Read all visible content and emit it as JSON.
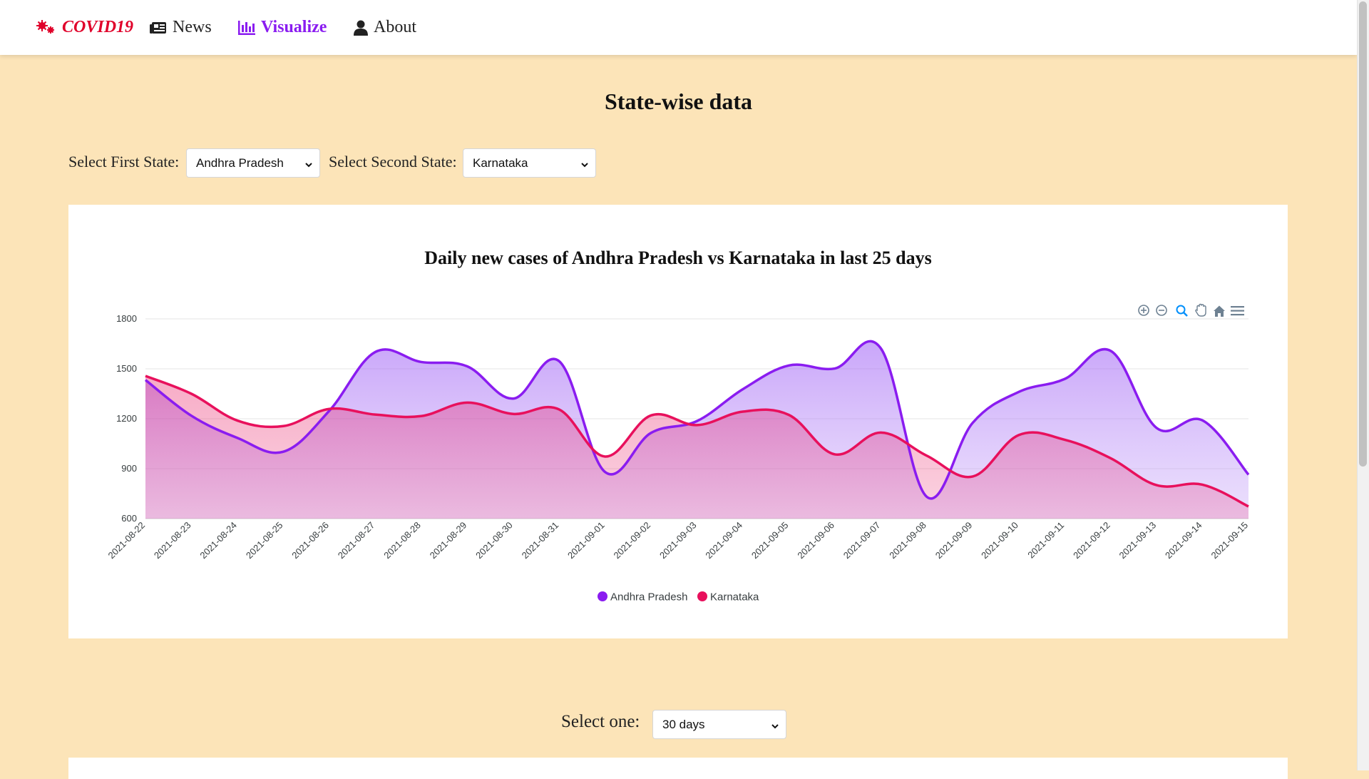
{
  "navbar": {
    "brand": "COVID19",
    "items": [
      {
        "label": "News",
        "icon": "newspaper-icon"
      },
      {
        "label": "Visualize",
        "icon": "bar-chart-icon",
        "active": true
      },
      {
        "label": "About",
        "icon": "user-icon"
      }
    ]
  },
  "page": {
    "title": "State-wise data",
    "first_state_label": "Select First State:",
    "first_state_value": "Andhra Pradesh",
    "second_state_label": "Select Second State:",
    "second_state_value": "Karnataka",
    "select_one_label": "Select one:",
    "select_one_value": "30 days"
  },
  "colors": {
    "background": "#fce4b8",
    "brand": "#e0002a",
    "accent": "#8a1cf0",
    "series_1": "#8a1cf0",
    "series_2": "#e8105c"
  },
  "toolbar_icons": [
    "zoom-in-icon",
    "zoom-out-icon",
    "selection-zoom-icon",
    "pan-hand-icon",
    "home-reset-icon",
    "menu-icon"
  ],
  "chart_data": {
    "type": "area",
    "title": "Daily new cases of Andhra Pradesh vs Karnataka in last 25 days",
    "x": [
      "2021-08-22",
      "2021-08-23",
      "2021-08-24",
      "2021-08-25",
      "2021-08-26",
      "2021-08-27",
      "2021-08-28",
      "2021-08-29",
      "2021-08-30",
      "2021-08-31",
      "2021-09-01",
      "2021-09-02",
      "2021-09-03",
      "2021-09-04",
      "2021-09-05",
      "2021-09-06",
      "2021-09-07",
      "2021-09-08",
      "2021-09-09",
      "2021-09-10",
      "2021-09-11",
      "2021-09-12",
      "2021-09-13",
      "2021-09-14",
      "2021-09-15"
    ],
    "series": [
      {
        "name": "Andhra Pradesh",
        "values": [
          1433,
          1218,
          1085,
          1002,
          1248,
          1601,
          1541,
          1515,
          1321,
          1546,
          880,
          1115,
          1186,
          1378,
          1520,
          1502,
          1623,
          731,
          1176,
          1361,
          1439,
          1608,
          1145,
          1190,
          864
        ]
      },
      {
        "name": "Karnataka",
        "values": [
          1457,
          1350,
          1189,
          1156,
          1259,
          1225,
          1216,
          1297,
          1229,
          1256,
          973,
          1220,
          1162,
          1243,
          1223,
          986,
          1117,
          978,
          853,
          1102,
          1074,
          963,
          801,
          804,
          673
        ]
      }
    ],
    "ylim": [
      600,
      1800
    ],
    "yticks": [
      600,
      900,
      1200,
      1500,
      1800
    ],
    "grid": true,
    "legend": "bottom-center"
  }
}
